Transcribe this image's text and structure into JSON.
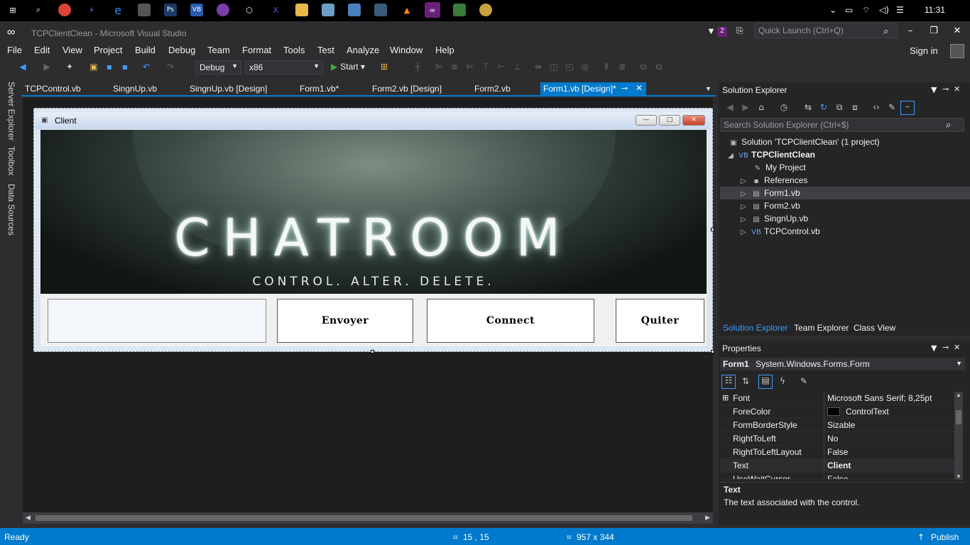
{
  "taskbar": {
    "clock": "11:31"
  },
  "window": {
    "title": "TCPClientClean - Microsoft Visual Studio",
    "notification_count": "2",
    "quick_launch_placeholder": "Quick Launch (Ctrl+Q)"
  },
  "menu": [
    "File",
    "Edit",
    "View",
    "Project",
    "Build",
    "Debug",
    "Team",
    "Format",
    "Tools",
    "Test",
    "Analyze",
    "Window",
    "Help"
  ],
  "signin": "Sign in",
  "toolbar": {
    "config": "Debug",
    "platform": "x86",
    "start": "Start"
  },
  "left_rail": [
    "Server Explorer",
    "Toolbox",
    "Data Sources"
  ],
  "tabs": [
    "TCPControl.vb",
    "SingnUp.vb",
    "SingnUp.vb [Design]",
    "Form1.vb*",
    "Form2.vb [Design]",
    "Form2.vb",
    "Form1.vb [Design]*"
  ],
  "form": {
    "title": "Client",
    "banner_title": "CHATROOM",
    "banner_tagline": "CONTROL. ALTER. DELETE.",
    "buttons": {
      "send": "Envoyer",
      "connect": "Connect",
      "quit": "Quiter"
    }
  },
  "solution_explorer": {
    "title": "Solution Explorer",
    "search_placeholder": "Search Solution Explorer (Ctrl+$)",
    "solution": "Solution 'TCPClientClean' (1 project)",
    "project": "TCPClientClean",
    "items": [
      "My Project",
      "References",
      "Form1.vb",
      "Form2.vb",
      "SingnUp.vb",
      "TCPControl.vb"
    ],
    "bottom_tabs": [
      "Solution Explorer",
      "Team Explorer",
      "Class View"
    ]
  },
  "properties": {
    "title": "Properties",
    "object_name": "Form1",
    "object_type": "System.Windows.Forms.Form",
    "rows": [
      {
        "name": "Font",
        "value": "Microsoft Sans Serif; 8,25pt"
      },
      {
        "name": "ForeColor",
        "value": "ControlText"
      },
      {
        "name": "FormBorderStyle",
        "value": "Sizable"
      },
      {
        "name": "RightToLeft",
        "value": "No"
      },
      {
        "name": "RightToLeftLayout",
        "value": "False"
      },
      {
        "name": "Text",
        "value": "Client"
      },
      {
        "name": "UseWaitCursor",
        "value": "False"
      }
    ],
    "desc_title": "Text",
    "desc_text": "The text associated with the control."
  },
  "status": {
    "ready": "Ready",
    "position": "15 , 15",
    "size": "957 x 344",
    "publish": "Publish"
  },
  "colors": {
    "accent": "#007acc",
    "background": "#2d2d30",
    "start_green": "#3bb03b"
  }
}
